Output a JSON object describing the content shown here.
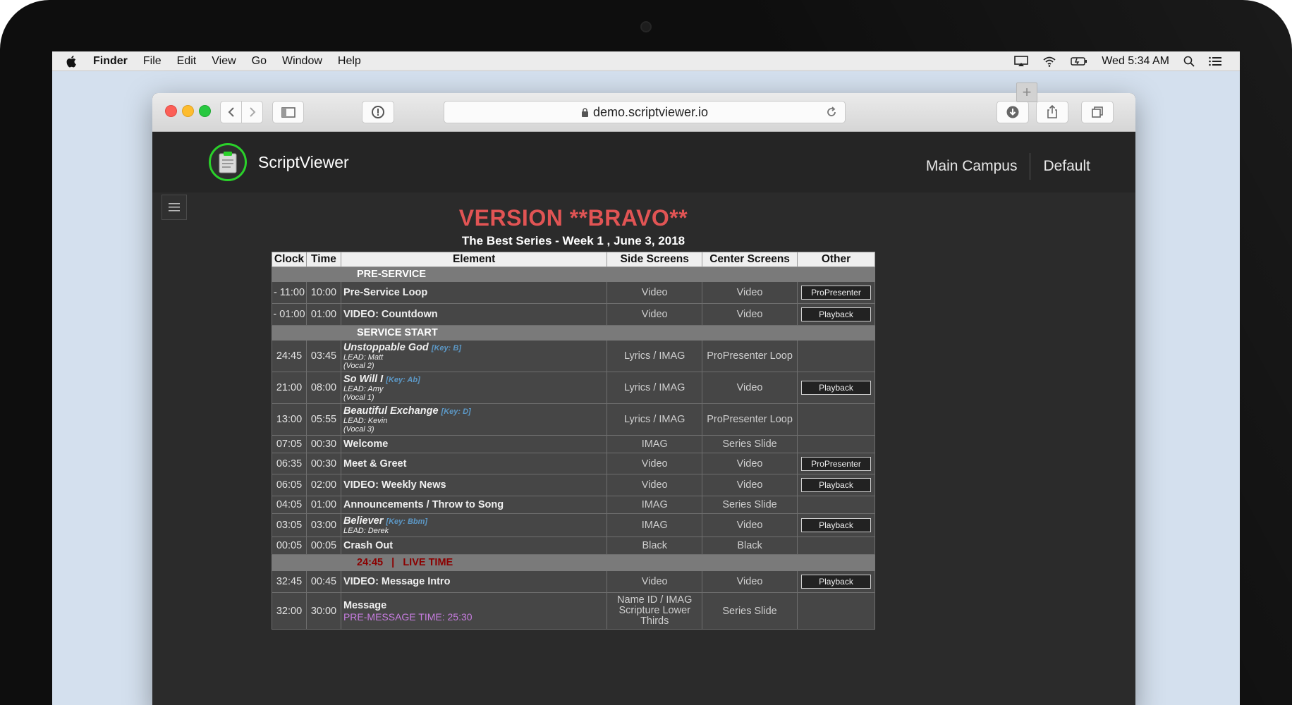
{
  "menubar": {
    "app": "Finder",
    "items": [
      "File",
      "Edit",
      "View",
      "Go",
      "Window",
      "Help"
    ],
    "clock": "Wed 5:34 AM"
  },
  "browser": {
    "url": "demo.scriptviewer.io"
  },
  "header": {
    "brand": "ScriptViewer",
    "campus": "Main Campus",
    "profile": "Default"
  },
  "page": {
    "version_title": "VERSION **BRAVO**",
    "subtitle": "The Best Series - Week 1 , June 3, 2018"
  },
  "schedule": {
    "columns": [
      "Clock",
      "Time",
      "Element",
      "Side Screens",
      "Center Screens",
      "Other"
    ],
    "sections": {
      "pre_service": "PRE-SERVICE",
      "service_start": "SERVICE START",
      "live_time": "24:45   |   LIVE TIME"
    },
    "rows": [
      {
        "clock": "- 11:00",
        "time": "10:00",
        "element": "Pre-Service Loop",
        "side": "Video",
        "center": "Video",
        "other": "ProPresenter"
      },
      {
        "clock": "- 01:00",
        "time": "01:00",
        "element": "VIDEO: Countdown",
        "side": "Video",
        "center": "Video",
        "other": "Playback"
      },
      {
        "clock": "24:45",
        "time": "03:45",
        "element": "Unstoppable God",
        "key": "[Key: B]",
        "lead": "LEAD: Matt",
        "vocal": "(Vocal 2)",
        "side": "Lyrics / IMAG",
        "center": "ProPresenter Loop",
        "other": ""
      },
      {
        "clock": "21:00",
        "time": "08:00",
        "element": "So Will I",
        "key": "[Key: Ab]",
        "lead": "LEAD: Amy",
        "vocal": "(Vocal 1)",
        "side": "Lyrics / IMAG",
        "center": "Video",
        "other": "Playback"
      },
      {
        "clock": "13:00",
        "time": "05:55",
        "element": "Beautiful Exchange",
        "key": "[Key: D]",
        "lead": "LEAD: Kevin",
        "vocal": "(Vocal 3)",
        "side": "Lyrics / IMAG",
        "center": "ProPresenter Loop",
        "other": ""
      },
      {
        "clock": "07:05",
        "time": "00:30",
        "element": "Welcome",
        "side": "IMAG",
        "center": "Series Slide",
        "other": ""
      },
      {
        "clock": "06:35",
        "time": "00:30",
        "element": "Meet & Greet",
        "side": "Video",
        "center": "Video",
        "other": "ProPresenter"
      },
      {
        "clock": "06:05",
        "time": "02:00",
        "element": "VIDEO: Weekly News",
        "side": "Video",
        "center": "Video",
        "other": "Playback"
      },
      {
        "clock": "04:05",
        "time": "01:00",
        "element": "Announcements / Throw to Song",
        "side": "IMAG",
        "center": "Series Slide",
        "other": ""
      },
      {
        "clock": "03:05",
        "time": "03:00",
        "element": "Believer",
        "key": "[Key: Bbm]",
        "lead": "LEAD: Derek",
        "side": "IMAG",
        "center": "Video",
        "other": "Playback"
      },
      {
        "clock": "00:05",
        "time": "00:05",
        "element": "Crash Out",
        "side": "Black",
        "center": "Black",
        "other": ""
      },
      {
        "clock": "32:45",
        "time": "00:45",
        "element": "VIDEO: Message Intro",
        "side": "Video",
        "center": "Video",
        "other": "Playback"
      },
      {
        "clock": "32:00",
        "time": "30:00",
        "element": "Message",
        "pre": "PRE-MESSAGE TIME:  25:30",
        "side": "Name ID / IMAG Scripture Lower Thirds",
        "center": "Series Slide",
        "other": ""
      }
    ]
  },
  "colors": {
    "version_title": "#e15454",
    "key_text": "#5c98c6",
    "live_time": "#8b0000",
    "pre_message": "#c77de0",
    "logo_ring": "#2ad12a"
  }
}
